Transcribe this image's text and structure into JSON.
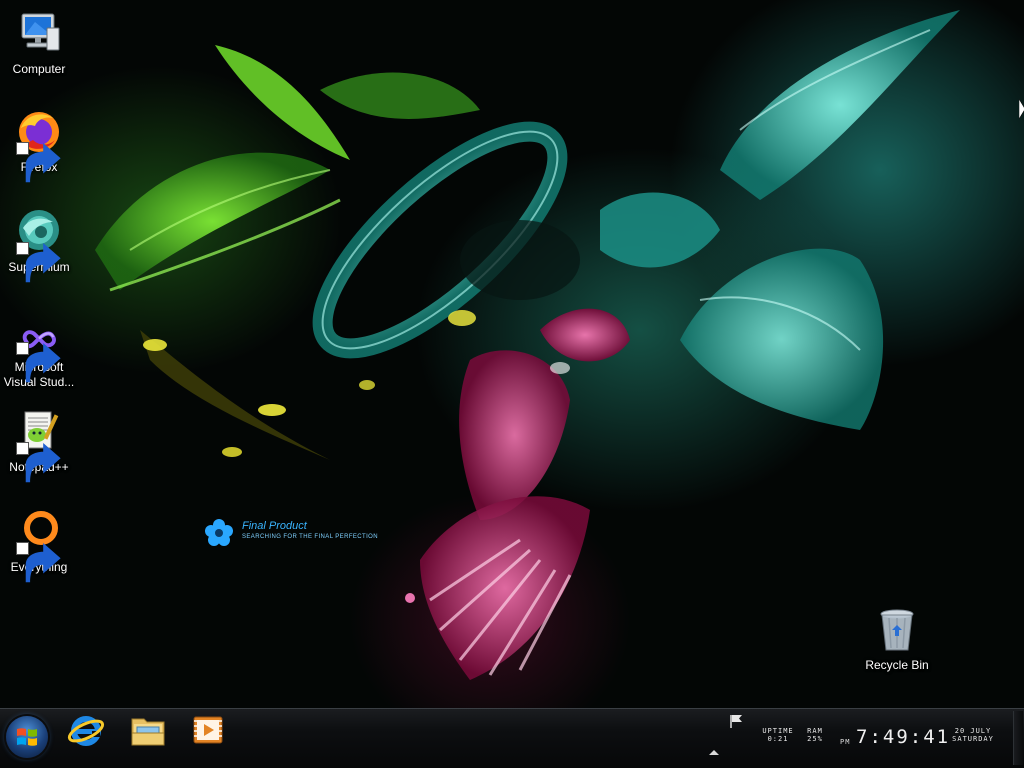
{
  "desktop_icons": [
    {
      "name": "computer-icon",
      "label": "Computer",
      "shortcut": false
    },
    {
      "name": "firefox-icon",
      "label": "Firefox",
      "shortcut": true
    },
    {
      "name": "supermium-icon",
      "label": "Supermium",
      "shortcut": true
    },
    {
      "name": "visual-studio-icon",
      "label": "Microsoft Visual Stud...",
      "shortcut": true
    },
    {
      "name": "notepadpp-icon",
      "label": "Notepad++",
      "shortcut": true
    },
    {
      "name": "everything-icon",
      "label": "Everything",
      "shortcut": true
    },
    {
      "name": "recycle-bin-icon",
      "label": "Recycle Bin",
      "shortcut": false
    }
  ],
  "wallpaper_brand": {
    "title": "Final Product",
    "subtitle": "Searching for the final perfection",
    "icon": "flower-icon"
  },
  "taskbar": {
    "start_icon": "windows-orb-icon",
    "pinned": [
      {
        "name": "internet-explorer-icon"
      },
      {
        "name": "file-explorer-icon"
      },
      {
        "name": "media-player-icon"
      }
    ],
    "tray": {
      "flag_icon": "action-center-flag-icon",
      "chevron_icon": "show-hidden-icons-chevron-icon",
      "uptime_label": "UPTIME",
      "uptime_value": "0:21",
      "ram_label": "RAM",
      "ram_value": "25%",
      "ampm": "PM",
      "time": "7:49:41",
      "date": "20 JULY",
      "weekday": "SATURDAY"
    }
  },
  "colors": {
    "text": "#ffffff",
    "brand_blue": "#3ab4ff",
    "taskbar": "#0d0f11"
  }
}
